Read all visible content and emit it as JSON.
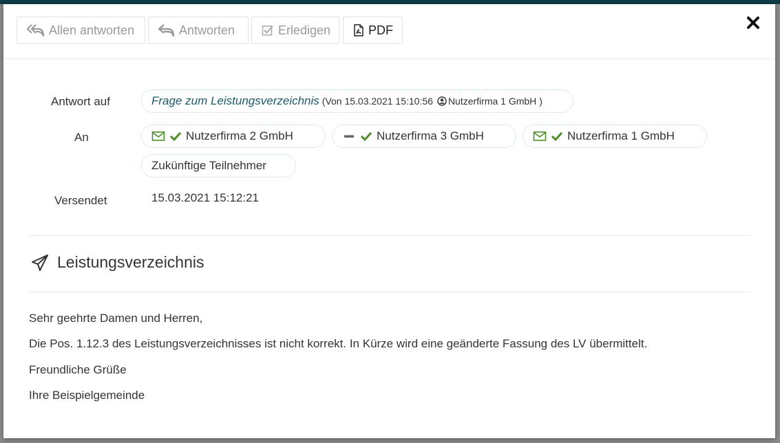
{
  "toolbar": {
    "reply_all_label": "Allen antworten",
    "reply_label": "Antworten",
    "done_label": "Erledigen",
    "pdf_label": "PDF"
  },
  "meta": {
    "reply_to_label": "Antwort auf",
    "to_label": "An",
    "sent_label": "Versendet",
    "reply_to": {
      "subject": "Frage zum Leistungsverzeichnis",
      "from_prefix": "(Von 15.03.2021 15:10:56",
      "sender": "Nutzerfirma 1 GmbH",
      "suffix": ")"
    },
    "recipients": [
      {
        "name": "Nutzerfirma 2 GmbH",
        "channel_icon": "envelope-icon",
        "status_icon": "check-icon"
      },
      {
        "name": "Nutzerfirma 3 GmbH",
        "channel_icon": "minus-icon",
        "status_icon": "check-icon"
      },
      {
        "name": "Nutzerfirma 1 GmbH",
        "channel_icon": "envelope-icon",
        "status_icon": "check-icon"
      }
    ],
    "future_participants": "Zukünftige Teilnehmer",
    "sent_at": "15.03.2021 15:12:21"
  },
  "message": {
    "subject": "Leistungsverzeichnis",
    "lines": [
      "Sehr geehrte Damen und Herren,",
      "Die Pos. 1.12.3 des Leistungsverzeichnisses ist nicht korrekt. In Kürze wird eine geänderte Fassung des LV übermittelt.",
      "Freundliche Grüße",
      "Ihre Beispielgemeinde"
    ]
  },
  "colors": {
    "check": "#4a8f2a",
    "link": "#1a5a6a",
    "header_bar": "#0f3b47"
  }
}
